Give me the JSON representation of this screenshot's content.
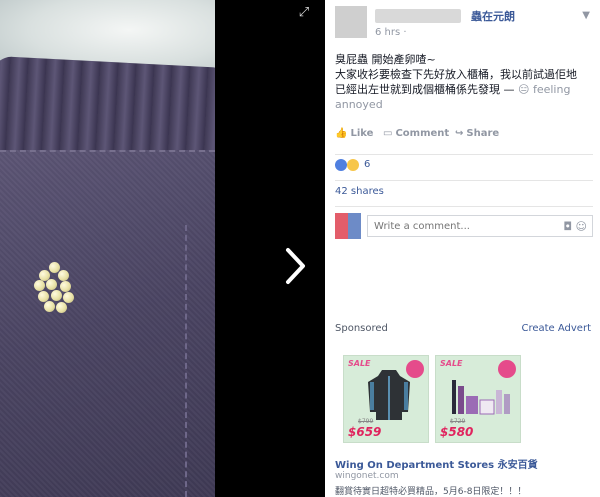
{
  "post": {
    "page_name": "蟲在元朗",
    "time": "6 hrs ·",
    "line1": "臭屁蟲 開始產卵喳~",
    "line2": "大家收衫要檢查下先好放入櫃桶，我以前試過佢地",
    "line3a": "已經出左世就到成個櫃桶係先發現 — ",
    "feeling": "feeling",
    "line4": "annoyed"
  },
  "actions": {
    "like": "Like",
    "comment": "Comment",
    "share": "Share"
  },
  "reactions": {
    "count": "6"
  },
  "shares": "42 shares",
  "comment_box": {
    "placeholder": "Write a comment..."
  },
  "sponsored": {
    "label": "Sponsored",
    "create_advert": "Create Advert"
  },
  "ads": [
    {
      "sale": "SALE",
      "old_price": "$799",
      "price": "$659"
    },
    {
      "sale": "SALE",
      "old_price": "$729",
      "price": "$580"
    }
  ],
  "ad_text": {
    "title": "Wing On Department Stores 永安百貨",
    "url": "wingonet.com",
    "desc": "翻賞待實日超特必買精品，5月6-8日限定！！！"
  },
  "colors": {
    "link": "#3b5998",
    "muted": "#9197a3",
    "sale": "#e54b8b"
  },
  "icons": {
    "expand": "expand-icon",
    "next": "chevron-right-icon",
    "camera": "camera-icon",
    "sticker": "sticker-icon"
  }
}
